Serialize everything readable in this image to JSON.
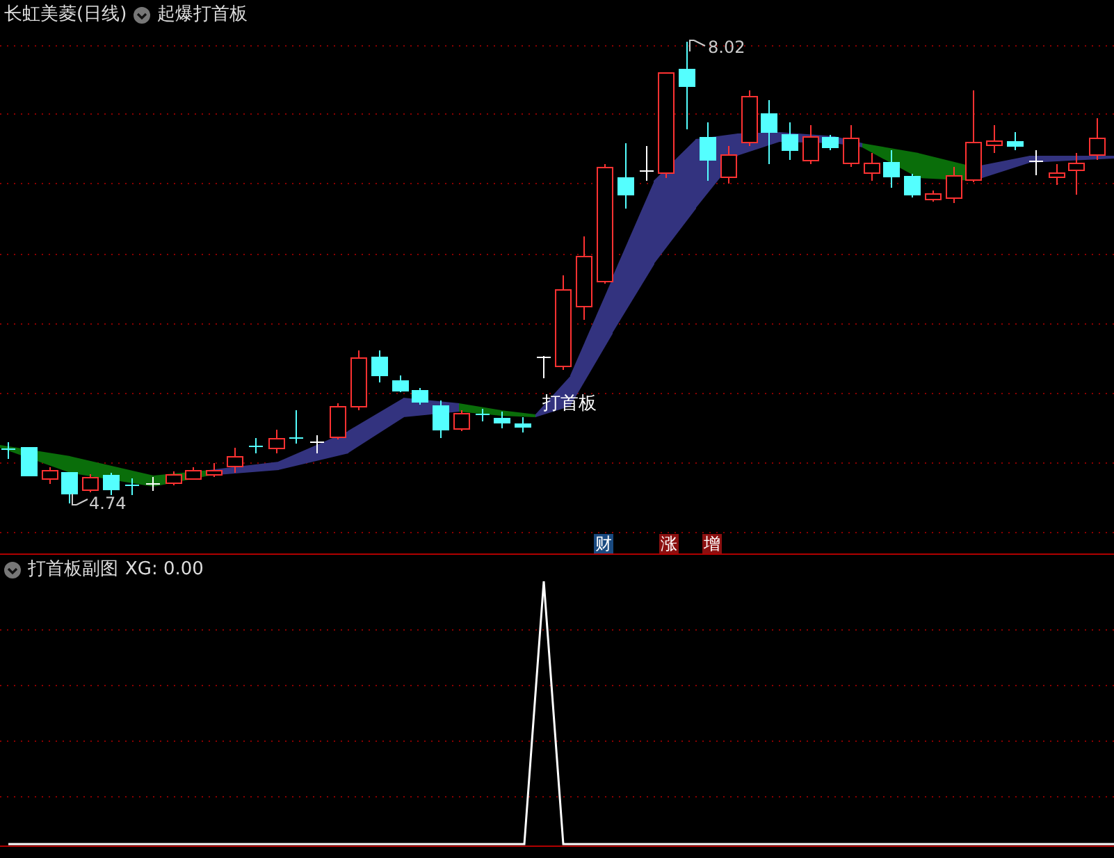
{
  "main_chart": {
    "title": "长虹美菱(日线)",
    "indicator": "起爆打首板",
    "high_label": "8.02",
    "low_label": "4.74",
    "signal_label": "打首板",
    "markers": [
      {
        "text": "财",
        "color": "#1a4a80"
      },
      {
        "text": "涨",
        "color": "#8b1010"
      },
      {
        "text": "增",
        "color": "#8b1010"
      }
    ]
  },
  "sub_chart": {
    "title": "打首板副图",
    "reading": "XG: 0.00"
  }
}
